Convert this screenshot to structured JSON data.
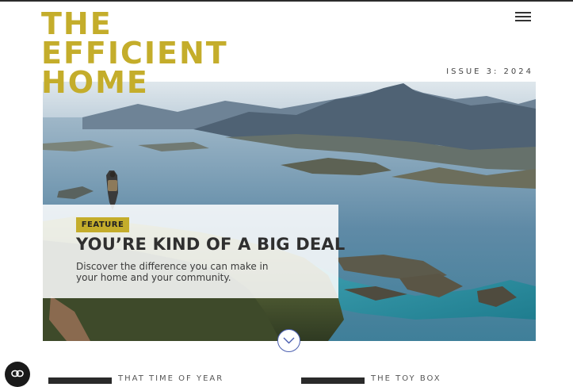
{
  "site": {
    "logo_lines": [
      "THE",
      "EFFICIENT",
      "HOME"
    ]
  },
  "header": {
    "issue": "ISSUE 3: 2024",
    "menu_icon": "hamburger-menu-icon"
  },
  "hero": {
    "badge": "FEATURE",
    "headline": "YOU’RE KIND OF A BIG DEAL",
    "description": "Discover the difference you can make in your home and your community.",
    "image": "hiker-overlooking-fjord-coastline",
    "scroll_icon": "chevron-down-icon"
  },
  "teasers": [
    {
      "title": "THAT TIME OF YEAR"
    },
    {
      "title": "THE TOY BOX"
    }
  ],
  "colors": {
    "accent": "#c4ad2b",
    "text": "#2f2f2f",
    "scroll_ring": "#4b5fb0"
  }
}
